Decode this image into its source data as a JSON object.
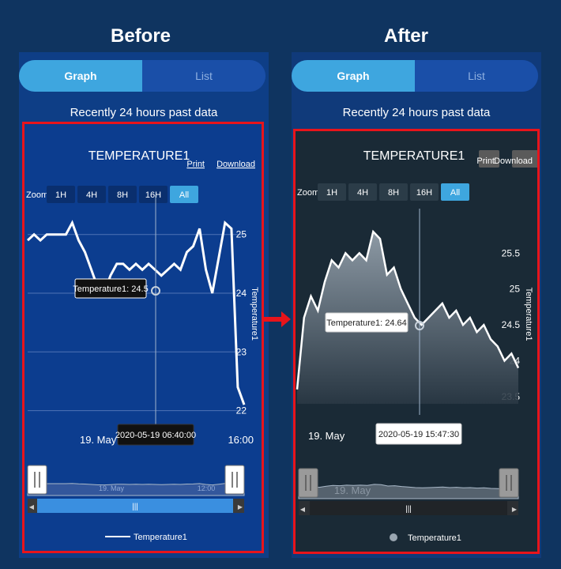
{
  "headings": {
    "before": "Before",
    "after": "After"
  },
  "tabs": {
    "graph": "Graph",
    "list": "List"
  },
  "subtitle": "Recently 24 hours past data",
  "chart_data": [
    {
      "type": "line",
      "panel": "before",
      "title": "TEMPERATURE1",
      "print_label": "Print",
      "download_label": "Download",
      "zoom_label": "Zoom",
      "zoom_buttons": [
        "1H",
        "4H",
        "8H",
        "16H",
        "All"
      ],
      "zoom_active": "All",
      "ylabel": "Temperature1",
      "yticks": [
        25,
        24,
        23,
        22
      ],
      "ylim": [
        21.9,
        25.4
      ],
      "xticks": [
        "19. May",
        "16:00"
      ],
      "tooltip": "Temperature1: 24.5",
      "crosshair_label": "2020-05-19 06:40:00",
      "navigator_labels": [
        "19. May",
        "12:00"
      ],
      "legend": "Temperature1",
      "series": [
        {
          "name": "Temperature1",
          "values": [
            24.9,
            25.0,
            24.9,
            25.0,
            25.0,
            25.0,
            25.0,
            25.2,
            24.9,
            24.7,
            24.4,
            24.1,
            24.0,
            24.3,
            24.5,
            24.5,
            24.4,
            24.5,
            24.4,
            24.5,
            24.4,
            24.3,
            24.4,
            24.5,
            24.4,
            24.7,
            24.8,
            25.1,
            24.4,
            24.0,
            24.6,
            25.2,
            25.1,
            22.4,
            22.1
          ]
        }
      ]
    },
    {
      "type": "area",
      "panel": "after",
      "title": "TEMPERATURE1",
      "print_label": "Print",
      "download_label": "Download",
      "zoom_label": "Zoom",
      "zoom_buttons": [
        "1H",
        "4H",
        "8H",
        "16H",
        "All"
      ],
      "zoom_active": "All",
      "ylabel": "Temperature1",
      "yticks": [
        25.5,
        25,
        24.5,
        24,
        23.5
      ],
      "ylim": [
        23.4,
        25.9
      ],
      "xticks": [
        "19. May"
      ],
      "tooltip": "Temperature1: 24.64",
      "crosshair_label": "2020-05-19 15:47:30",
      "navigator_labels": [
        "19. May"
      ],
      "legend": "Temperature1",
      "series": [
        {
          "name": "Temperature1",
          "values": [
            23.6,
            24.6,
            24.9,
            24.7,
            25.1,
            25.4,
            25.3,
            25.5,
            25.4,
            25.5,
            25.4,
            25.8,
            25.7,
            25.2,
            25.3,
            25.0,
            24.8,
            24.6,
            24.5,
            24.6,
            24.7,
            24.8,
            24.6,
            24.7,
            24.5,
            24.6,
            24.4,
            24.5,
            24.3,
            24.2,
            24.0,
            24.1,
            23.9
          ]
        }
      ]
    }
  ]
}
